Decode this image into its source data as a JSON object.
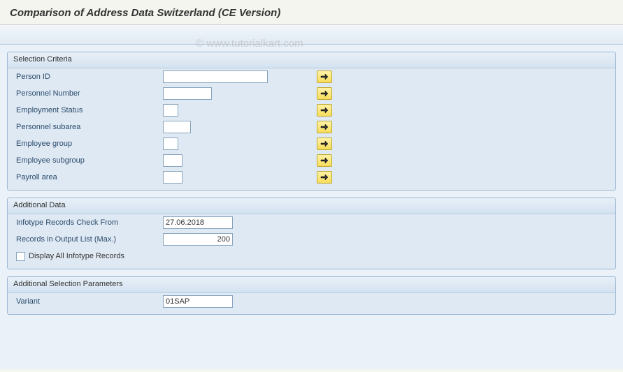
{
  "title": "Comparison of Address Data Switzerland (CE Version)",
  "watermark": "© www.tutorialkart.com",
  "groups": {
    "selection": {
      "title": "Selection Criteria",
      "fields": {
        "person_id": {
          "label": "Person ID",
          "value": ""
        },
        "personnel_number": {
          "label": "Personnel Number",
          "value": ""
        },
        "employment_status": {
          "label": "Employment Status",
          "value": ""
        },
        "personnel_subarea": {
          "label": "Personnel subarea",
          "value": ""
        },
        "employee_group": {
          "label": "Employee group",
          "value": ""
        },
        "employee_subgroup": {
          "label": "Employee subgroup",
          "value": ""
        },
        "payroll_area": {
          "label": "Payroll area",
          "value": ""
        }
      }
    },
    "additional_data": {
      "title": "Additional Data",
      "fields": {
        "check_from": {
          "label": "Infotype Records Check From",
          "value": "27.06.2018"
        },
        "max_records": {
          "label": "Records in Output List (Max.)",
          "value": "200"
        },
        "display_all": {
          "label": "Display All Infotype Records",
          "checked": false
        }
      }
    },
    "additional_params": {
      "title": "Additional Selection Parameters",
      "fields": {
        "variant": {
          "label": "Variant",
          "value": "01SAP"
        }
      }
    }
  }
}
